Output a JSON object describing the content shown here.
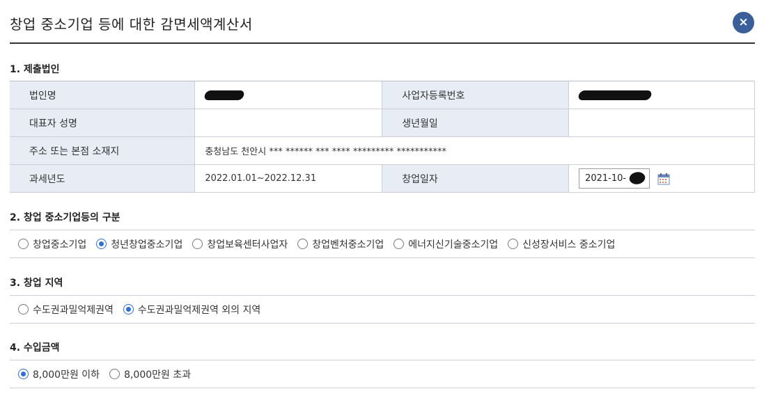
{
  "header": {
    "title": "창업 중소기업 등에 대한 감면세액계산서",
    "close_icon": "×"
  },
  "section1": {
    "title": "1. 제출법인",
    "rows": [
      {
        "label1": "법인명",
        "value1": "",
        "label2": "사업자등록번호",
        "value2": ""
      },
      {
        "label1": "대표자 성명",
        "value1": "",
        "label2": "생년월일",
        "value2": ""
      },
      {
        "label1": "주소 또는 본점 소재지",
        "value1": "충청남도 천안시 *** ****** *** **** ********* ***********"
      },
      {
        "label1": "과세년도",
        "value1": "2022.01.01~2022.12.31",
        "label2": "창업일자",
        "date_value": "2021-10-"
      }
    ]
  },
  "section2": {
    "title": "2. 창업 중소기업등의 구분",
    "options": [
      "창업중소기업",
      "청년창업중소기업",
      "창업보육센터사업자",
      "창업벤처중소기업",
      "에너지신기술중소기업",
      "신성장서비스 중소기업"
    ],
    "selected": 1
  },
  "section3": {
    "title": "3. 창업 지역",
    "options": [
      "수도권과밀억제권역",
      "수도권과밀억제권역 외의 지역"
    ],
    "selected": 1
  },
  "section4": {
    "title": "4. 수입금액",
    "options": [
      "8,000만원 이하",
      "8,000만원 초과"
    ],
    "selected": 0
  },
  "colors": {
    "accent": "#3a5f99",
    "label_bg": "#e8ecf4",
    "radio_checked": "#2f6fd6"
  },
  "icons": {
    "close": "close-icon",
    "calendar": "calendar-icon"
  }
}
